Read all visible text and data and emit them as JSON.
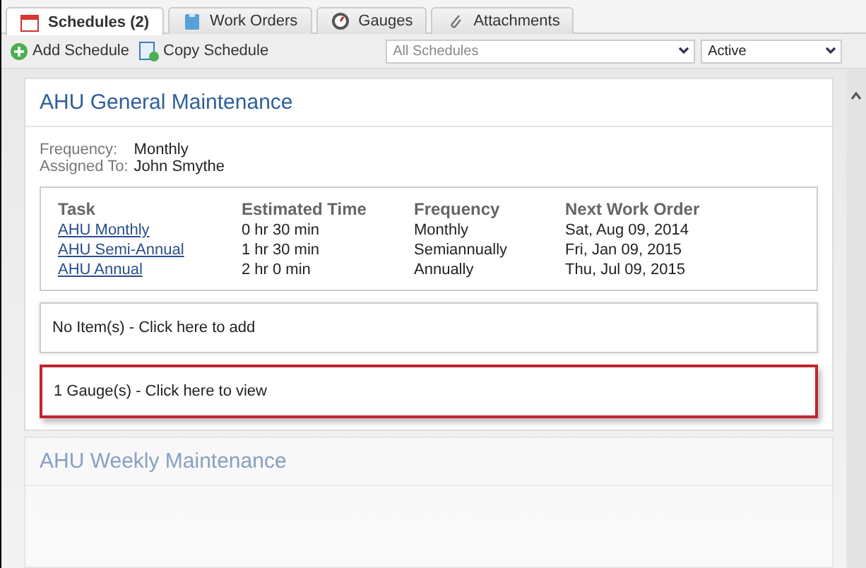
{
  "tabs": [
    {
      "label": "Schedules (2)",
      "kind": "calendar",
      "selected": true
    },
    {
      "label": "Work Orders",
      "kind": "clipboard",
      "selected": false
    },
    {
      "label": "Gauges",
      "kind": "gauge",
      "selected": false
    },
    {
      "label": "Attachments",
      "kind": "clip",
      "selected": false
    }
  ],
  "toolbar": {
    "buttons": [
      {
        "label": "Add Schedule",
        "kind": "add"
      },
      {
        "label": "Copy Schedule",
        "kind": "copy"
      }
    ],
    "filter": {
      "value": "All Schedules"
    },
    "status": {
      "value": "Active"
    }
  },
  "schedules": [
    {
      "title": "AHU General Maintenance",
      "details": [
        {
          "label": "Frequency:",
          "value": "Monthly"
        },
        {
          "label": "Assigned To:",
          "value": "John Smythe"
        }
      ],
      "table": {
        "columns": [
          "Task",
          "Estimated Time",
          "Frequency",
          "Next Work Order"
        ],
        "rows": [
          [
            "AHU Monthly",
            "0 hr 30 min",
            "Monthly",
            "Sat, Aug 09, 2014"
          ],
          [
            "AHU Semi-Annual",
            "1 hr 30 min",
            "Semiannually",
            "Fri, Jan 09, 2015"
          ],
          [
            "AHU Annual",
            "2 hr 0 min",
            "Annually",
            "Thu, Jul 09, 2015"
          ]
        ]
      },
      "links": [
        {
          "label": "No Item(s) - Click here to add",
          "highlighted": false
        },
        {
          "label": "1 Gauge(s) - Click here to view",
          "highlighted": true
        }
      ]
    },
    {
      "title": "AHU Weekly Maintenance"
    }
  ]
}
